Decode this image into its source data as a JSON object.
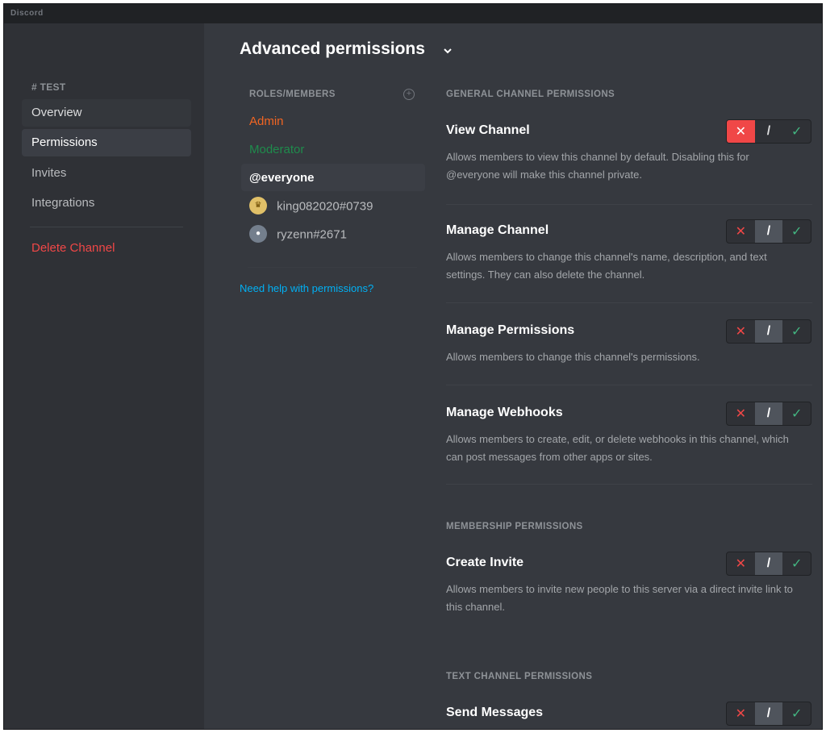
{
  "window": {
    "title": "Discord"
  },
  "sidebar": {
    "header": "# TEST",
    "items": [
      {
        "label": "Overview"
      },
      {
        "label": "Permissions"
      },
      {
        "label": "Invites"
      },
      {
        "label": "Integrations"
      }
    ],
    "delete_label": "Delete Channel"
  },
  "page": {
    "title": "Advanced permissions"
  },
  "roles": {
    "header": "ROLES/MEMBERS",
    "list": [
      {
        "label": "Admin",
        "color": "#f26522"
      },
      {
        "label": "Moderator",
        "color": "#1f8b4c"
      },
      {
        "label": "@everyone",
        "color": "#ffffff",
        "selected": true
      },
      {
        "label": "king082020#0739",
        "avatar": "trophy-avatar-icon"
      },
      {
        "label": "ryzenn#2671",
        "avatar": "discord-avatar-icon"
      }
    ],
    "help_link": "Need help with permissions?"
  },
  "sections": {
    "general": "GENERAL CHANNEL PERMISSIONS",
    "membership": "MEMBERSHIP PERMISSIONS",
    "text": "TEXT CHANNEL PERMISSIONS"
  },
  "permissions": [
    {
      "title": "View Channel",
      "desc": "Allows members to view this channel by default. Disabling this for @everyone will make this channel private.",
      "state": "deny"
    },
    {
      "title": "Manage Channel",
      "desc": "Allows members to change this channel's name, description, and text settings. They can also delete the channel.",
      "state": "neutral"
    },
    {
      "title": "Manage Permissions",
      "desc": "Allows members to change this channel's permissions.",
      "state": "neutral"
    },
    {
      "title": "Manage Webhooks",
      "desc": "Allows members to create, edit, or delete webhooks in this channel, which can post messages from other apps or sites.",
      "state": "neutral"
    },
    {
      "title": "Create Invite",
      "desc": "Allows members to invite new people to this server via a direct invite link to this channel.",
      "state": "neutral"
    },
    {
      "title": "Send Messages",
      "desc": "",
      "state": "neutral"
    }
  ],
  "toggle_glyphs": {
    "deny": "✕",
    "neutral": "/",
    "allow": "✓"
  },
  "colors": {
    "deny": "#f04747",
    "allow": "#43b581",
    "link": "#00b0f4",
    "danger": "#f04747"
  }
}
